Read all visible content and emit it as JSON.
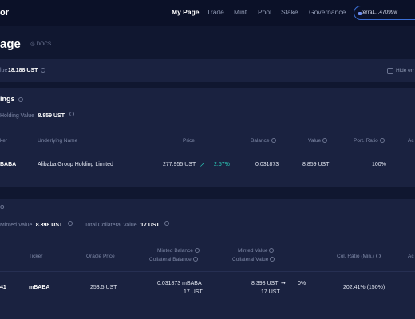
{
  "nav": {
    "brand": "or",
    "items": [
      "My Page",
      "Trade",
      "Mint",
      "Pool",
      "Stake",
      "Governance"
    ],
    "wallet": "terra1...47099w"
  },
  "page": {
    "title": "age",
    "docs": "DOCS"
  },
  "total": {
    "label": "lue",
    "value": "18.188 UST",
    "hide_label": "Hide err"
  },
  "holdings": {
    "title": "ings",
    "sub_label": "Holding Value",
    "sub_value": "8.859 UST",
    "headers": [
      "ker",
      "Underlying Name",
      "Price",
      "Balance",
      "Value",
      "Port. Ratio",
      "Ac"
    ],
    "row": {
      "ticker": "BABA",
      "name": "Alibaba Group Holding Limited",
      "price": "277.955 UST",
      "change": "2.57%",
      "balance": "0.031873",
      "value": "8.859 UST",
      "ratio": "100%"
    }
  },
  "mint": {
    "title_fragment": "O",
    "minted_label": "Minted Value",
    "minted_value": "8.398 UST",
    "collateral_label": "Total Collateral Value",
    "collateral_value": "17 UST",
    "headers": {
      "ticker": "Ticker",
      "oracle": "Oracle Price",
      "minted_balance": "Minted Balance",
      "collateral_balance": "Collateral Balance",
      "minted_value": "Minted Value",
      "collateral_value": "Collateral Value",
      "ratio": "Col. Ratio (Min.)",
      "action": "Ac"
    },
    "row": {
      "id": "41",
      "ticker": "mBABA",
      "oracle": "253.5 UST",
      "minted_balance": "0.031873 mBABA",
      "collateral_balance": "17 UST",
      "minted_value": "8.398 UST",
      "change": "0%",
      "collateral_value": "17 UST",
      "ratio": "202.41% (150%)"
    }
  }
}
